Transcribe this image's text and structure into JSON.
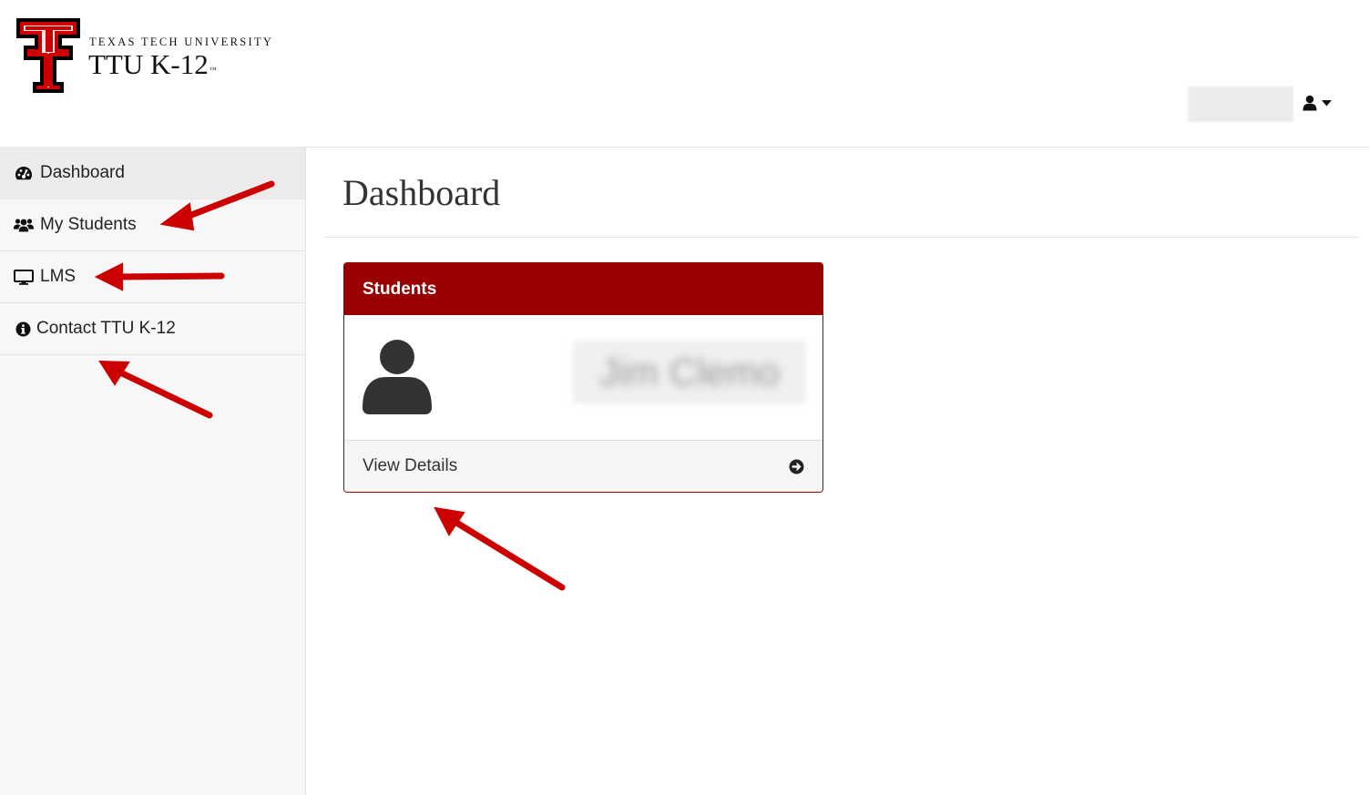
{
  "brand": {
    "university": "TEXAS TECH UNIVERSITY",
    "product": "TTU K-12",
    "trademark": "™",
    "logo_icon": "double-t-logo",
    "primary_color": "#cc0000",
    "dark_color": "#990000"
  },
  "header": {
    "user_menu_icon": "user-icon",
    "caret_icon": "caret-down-icon"
  },
  "sidebar": {
    "items": [
      {
        "label": "Dashboard",
        "icon": "dashboard-icon",
        "active": true
      },
      {
        "label": "My Students",
        "icon": "users-icon",
        "active": false
      },
      {
        "label": "LMS",
        "icon": "monitor-icon",
        "active": false
      },
      {
        "label": "Contact TTU K-12",
        "icon": "info-icon",
        "active": false
      }
    ]
  },
  "main": {
    "title": "Dashboard",
    "card": {
      "title": "Students",
      "student_name": "Jim Clemo",
      "avatar_icon": "user-avatar-icon",
      "footer_label": "View Details",
      "footer_icon": "arrow-circle-right-icon"
    }
  }
}
